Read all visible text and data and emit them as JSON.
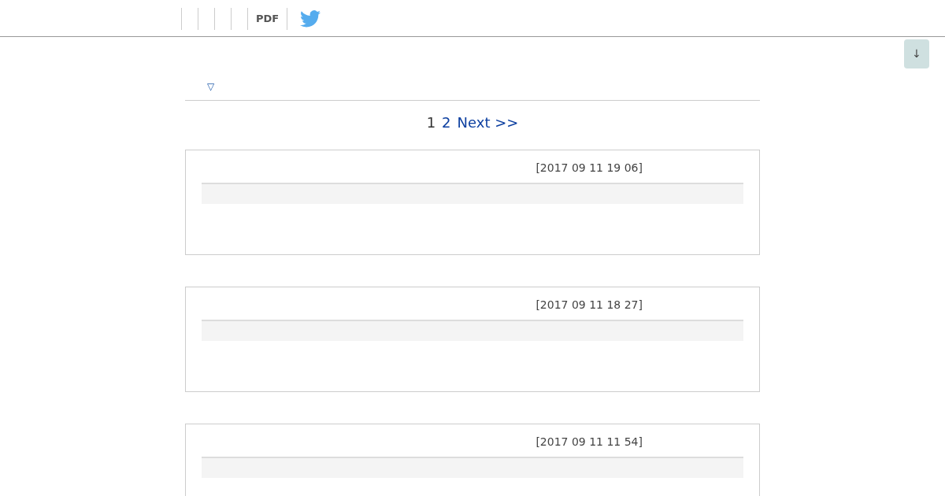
{
  "toolbar": {
    "pdf_label": "PDF"
  },
  "scroll_button": {
    "label": "↓"
  },
  "filter": {
    "toggle": "▽"
  },
  "pagination": {
    "pages": [
      {
        "label": "1",
        "selected": true
      },
      {
        "label": "2",
        "selected": false
      }
    ],
    "next": "Next >>"
  },
  "posts": [
    {
      "date": "[2017 09 11 19 06]"
    },
    {
      "date": "[2017 09 11 18 27]"
    },
    {
      "date": "[2017 09 11 11 54]"
    }
  ]
}
